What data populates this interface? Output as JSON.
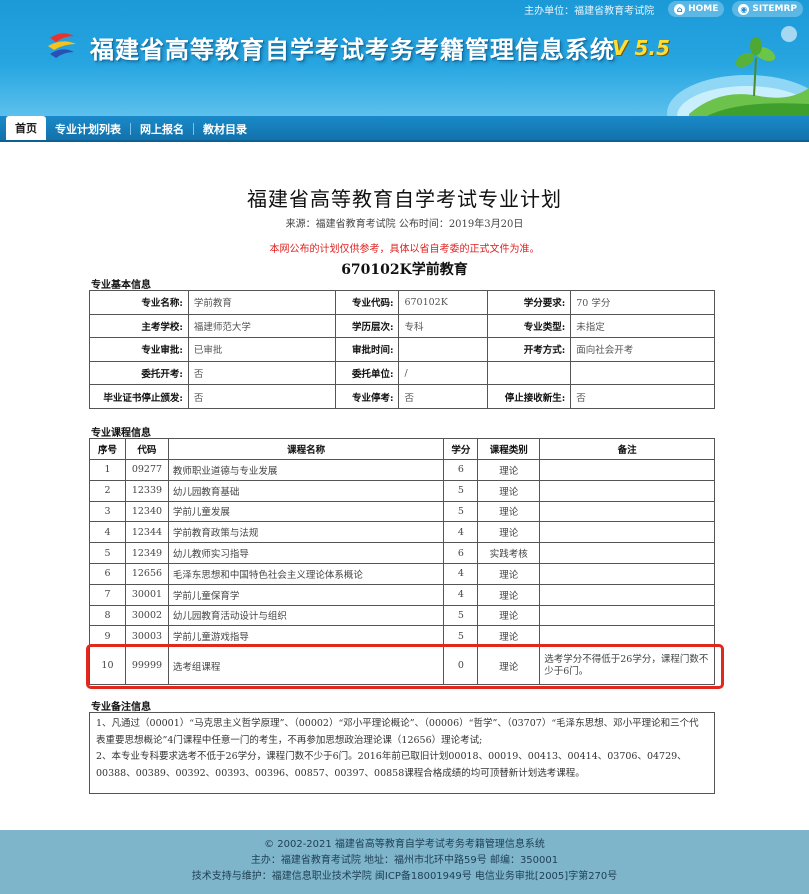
{
  "header": {
    "sponsor": "主办单位：福建省教育考试院",
    "home_label": "HOME",
    "sitemap_label": "SITEMRP",
    "title": "福建省高等教育自学考试考务考籍管理信息系统",
    "version": "V 5.5"
  },
  "tabs": [
    {
      "label": "首页",
      "active": true
    },
    {
      "label": "专业计划列表",
      "active": false
    },
    {
      "label": "网上报名",
      "active": false
    },
    {
      "label": "教材目录",
      "active": false
    }
  ],
  "page": {
    "title": "福建省高等教育自学考试专业计划",
    "source": "来源：福建省教育考试院 公布时间：2019年3月20日",
    "notice": "本网公布的计划仅供参考，具体以省自考委的正式文件为准。",
    "major_title": "670102K学前教育"
  },
  "basic_info": {
    "section_label": "专业基本信息",
    "rows": [
      [
        [
          "专业名称:",
          "学前教育"
        ],
        [
          "专业代码:",
          "670102K"
        ],
        [
          "学分要求:",
          "70 学分"
        ]
      ],
      [
        [
          "主考学校:",
          "福建师范大学"
        ],
        [
          "学历层次:",
          "专科"
        ],
        [
          "专业类型:",
          "未指定"
        ]
      ],
      [
        [
          "专业审批:",
          "已审批"
        ],
        [
          "审批时间:",
          ""
        ],
        [
          "开考方式:",
          "面向社会开考"
        ]
      ],
      [
        [
          "委托开考:",
          "否"
        ],
        [
          "委托单位:",
          "/"
        ],
        [
          "",
          ""
        ]
      ],
      [
        [
          "毕业证书停止颁发:",
          "否"
        ],
        [
          "专业停考:",
          "否"
        ],
        [
          "停止接收新生:",
          "否"
        ]
      ]
    ]
  },
  "courses": {
    "section_label": "专业课程信息",
    "headers": [
      "序号",
      "代码",
      "课程名称",
      "学分",
      "课程类别",
      "备注"
    ],
    "rows": [
      [
        "1",
        "09277",
        "教师职业道德与专业发展",
        "6",
        "理论",
        ""
      ],
      [
        "2",
        "12339",
        "幼儿园教育基础",
        "5",
        "理论",
        ""
      ],
      [
        "3",
        "12340",
        "学前儿童发展",
        "5",
        "理论",
        ""
      ],
      [
        "4",
        "12344",
        "学前教育政策与法规",
        "4",
        "理论",
        ""
      ],
      [
        "5",
        "12349",
        "幼儿教师实习指导",
        "6",
        "实践考核",
        ""
      ],
      [
        "6",
        "12656",
        "毛泽东思想和中国特色社会主义理论体系概论",
        "4",
        "理论",
        ""
      ],
      [
        "7",
        "30001",
        "学前儿童保育学",
        "4",
        "理论",
        ""
      ],
      [
        "8",
        "30002",
        "幼儿园教育活动设计与组织",
        "5",
        "理论",
        ""
      ],
      [
        "9",
        "30003",
        "学前儿童游戏指导",
        "5",
        "理论",
        ""
      ],
      [
        "10",
        "99999",
        "选考组课程",
        "0",
        "理论",
        "选考学分不得低于26学分，课程门数不少于6门。"
      ]
    ]
  },
  "remarks": {
    "section_label": "专业备注信息",
    "lines": [
      "1、凡通过（00001）“马克思主义哲学原理”、（00002）“邓小平理论概论”、（00006）“哲学”、（03707）“毛泽东思想、邓小平理论和三个代表重要思想概论”4门课程中任意一门的考生，不再参加思想政治理论课（12656）理论考试;",
      "2、本专业专科要求选考不低于26学分，课程门数不少于6门。2016年前已取旧计划00018、00019、00413、00414、03706、04729、00388、00389、00392、00393、00396、00857、00397、00858课程合格成绩的均可顶替新计划选考课程。"
    ]
  },
  "footer": {
    "line1": "© 2002-2021 福建省高等教育自学考试考务考籍管理信息系统",
    "line2": "主办：福建省教育考试院 地址：福州市北环中路59号 邮编：350001",
    "line3": "技术支持与维护：福建信息职业技术学院 闽ICP备18001949号 电信业务审批[2005]字第270号"
  },
  "colors": {
    "header_blue": "#26a5e1",
    "tabbar_blue": "#1272ab",
    "notice_red": "#e02020",
    "highlight_red": "#e0281c",
    "footer_bg": "#7fb5cb"
  }
}
